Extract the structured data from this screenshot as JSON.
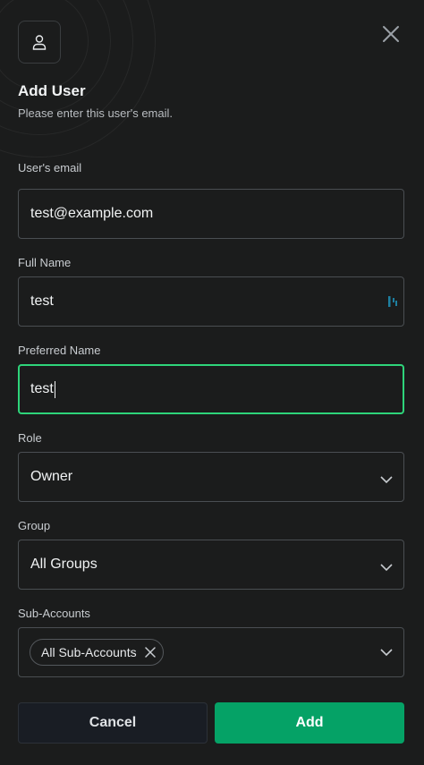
{
  "header": {
    "title": "Add User",
    "subtitle": "Please enter this user's email."
  },
  "form": {
    "email": {
      "label": "User's email",
      "value": "test@example.com"
    },
    "full_name": {
      "label": "Full Name",
      "value": "test"
    },
    "preferred_name": {
      "label": "Preferred Name",
      "value": "test"
    },
    "role": {
      "label": "Role",
      "value": "Owner"
    },
    "group": {
      "label": "Group",
      "value": "All Groups"
    },
    "sub_accounts": {
      "label": "Sub-Accounts",
      "chips": [
        "All Sub-Accounts"
      ]
    }
  },
  "actions": {
    "cancel_label": "Cancel",
    "add_label": "Add"
  },
  "colors": {
    "background": "#1b1c1c",
    "focus_border": "#2ed47a",
    "primary": "#05a266",
    "cancel_bg": "#191d24"
  },
  "icons": {
    "avatar": "user-icon",
    "close": "close-icon",
    "select": "chevron-down-icon",
    "chip_remove": "close-icon",
    "password_manager": "password-manager-icon"
  }
}
